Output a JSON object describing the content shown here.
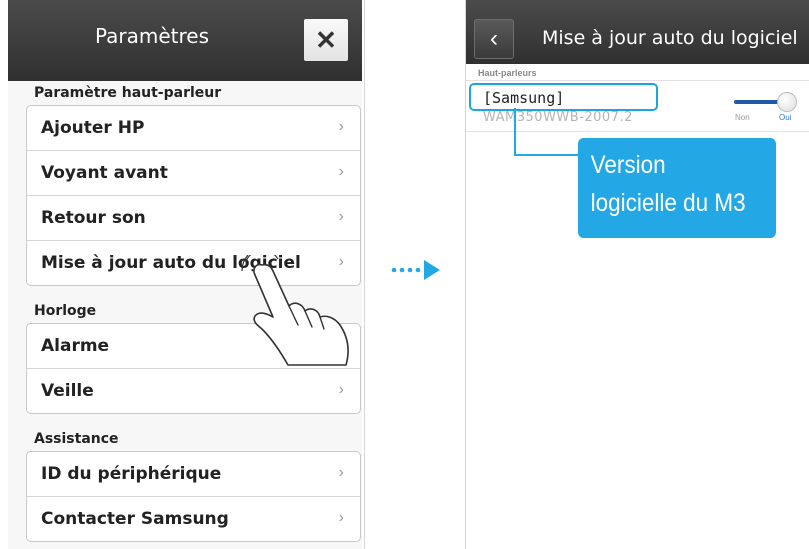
{
  "left_screen": {
    "title": "Paramètres",
    "close_icon": "close-icon",
    "sections": [
      {
        "heading": "Paramètre haut-parleur",
        "items": [
          "Ajouter HP",
          "Voyant avant",
          "Retour son",
          "Mise à jour auto du logiciel"
        ]
      },
      {
        "heading": "Horloge",
        "items": [
          "Alarme",
          "Veille"
        ]
      },
      {
        "heading": "Assistance",
        "items": [
          "ID du périphérique",
          "Contacter Samsung"
        ]
      }
    ],
    "chevron": "›"
  },
  "right_screen": {
    "title": "Mise à jour auto du logiciel",
    "back_icon": "‹",
    "section_label": "Haut-parleurs",
    "speaker_name": "[Samsung]",
    "speaker_version": "WAM350WWB-2007.2",
    "toggle_off_label": "Non",
    "toggle_on_label": "Oui",
    "toggle_state": "on"
  },
  "callout": {
    "line1": "Version",
    "line2": "logicielle du M3"
  },
  "colors": {
    "accent": "#23a7e5",
    "header": "#3a3a3a",
    "toggle": "#1e5aa8"
  }
}
